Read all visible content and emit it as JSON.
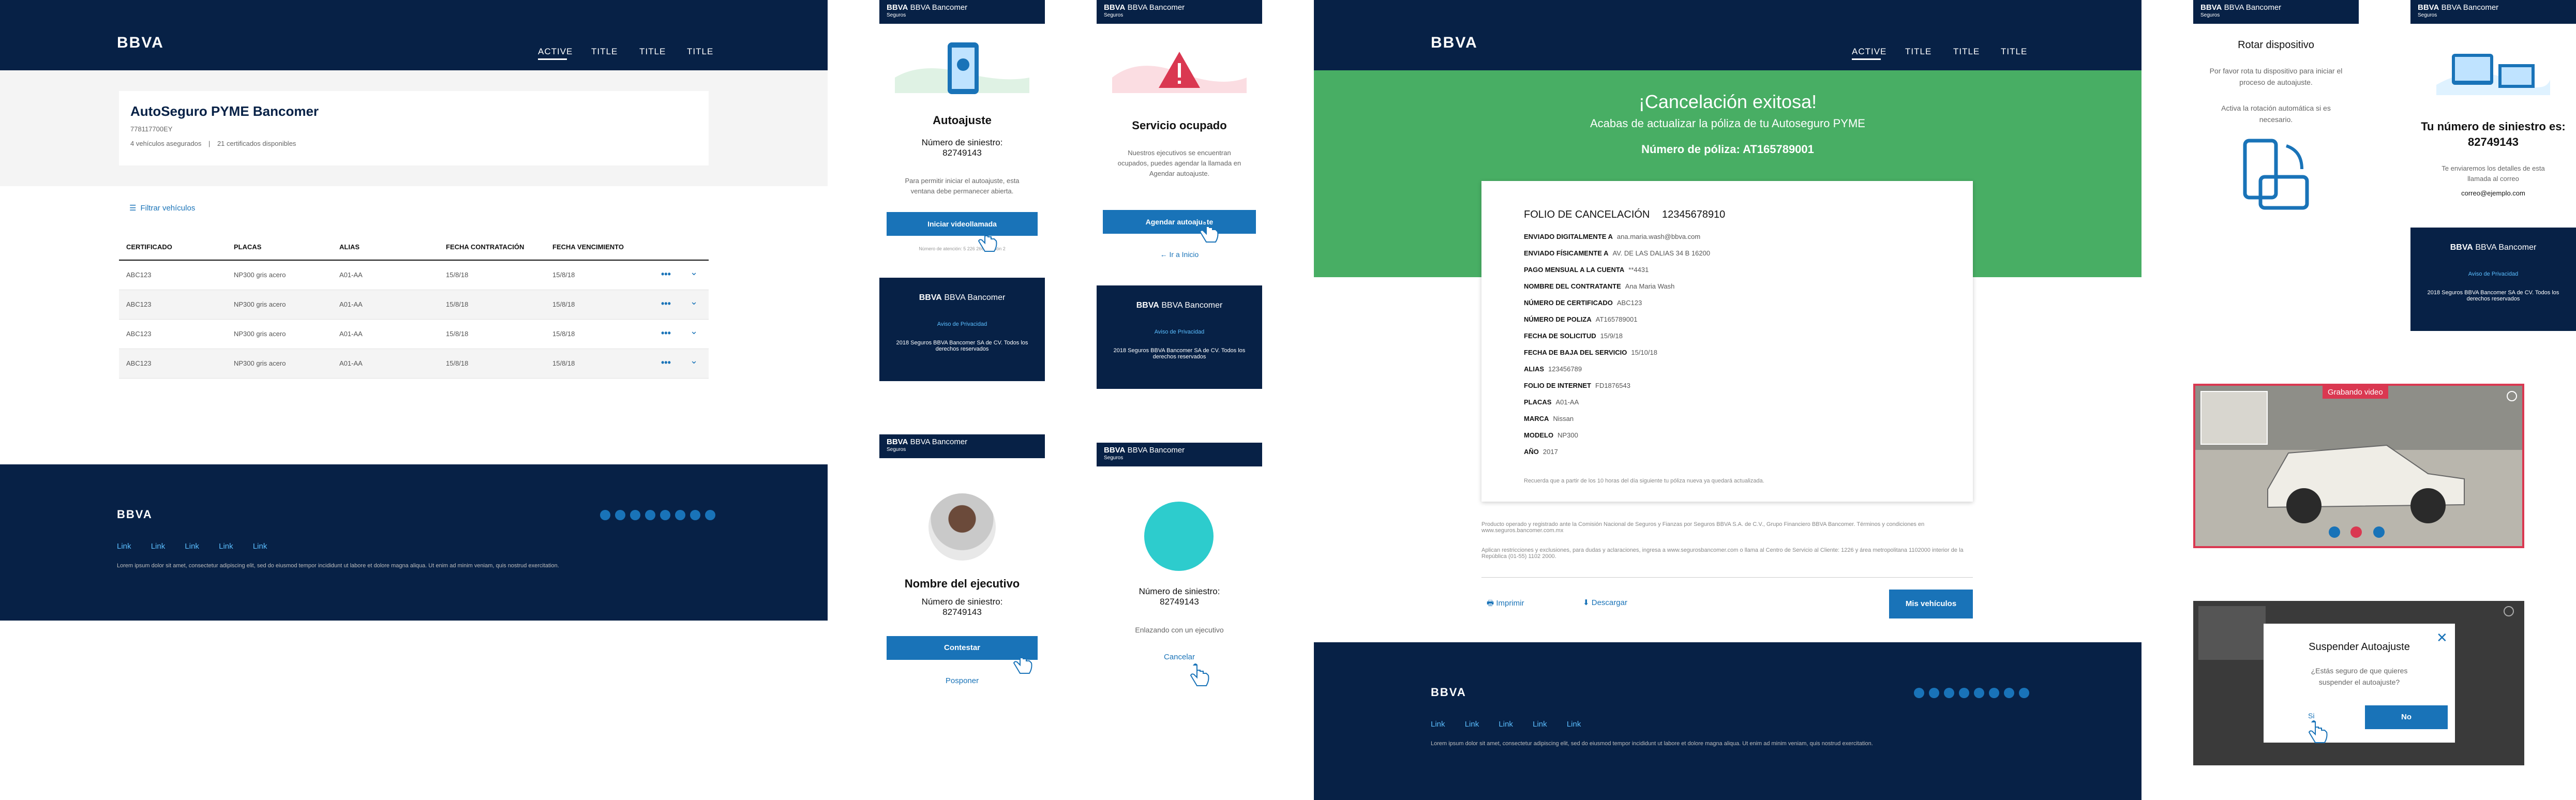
{
  "colors": {
    "navy": "#072146",
    "blue": "#1973b8",
    "green": "#48ae64",
    "red": "#da3851",
    "light": "#f4f4f4"
  },
  "s1": {
    "logo": "BBVA",
    "nav": [
      "ACTIVE",
      "TITLE",
      "TITLE",
      "TITLE"
    ],
    "card": {
      "title": "AutoSeguro PYME Bancomer",
      "id": "778117700EY",
      "vehicles": "4 vehículos asegurados",
      "sep": "|",
      "certs": "21 certificados disponibles"
    },
    "filter": "Filtrar vehículos",
    "headers": [
      "CERTIFICADO",
      "PLACAS",
      "ALIAS",
      "FECHA CONTRATACIÓN",
      "FECHA VENCIMIENTO"
    ],
    "rows": [
      [
        "ABC123",
        "NP300 gris acero",
        "A01-AA",
        "15/8/18",
        "15/8/18"
      ],
      [
        "ABC123",
        "NP300 gris acero",
        "A01-AA",
        "15/8/18",
        "15/8/18"
      ],
      [
        "ABC123",
        "NP300 gris acero",
        "A01-AA",
        "15/8/18",
        "15/8/18"
      ],
      [
        "ABC123",
        "NP300 gris acero",
        "A01-AA",
        "15/8/18",
        "15/8/18"
      ]
    ],
    "more": "•••",
    "chevron": "⌄",
    "footer": {
      "logo": "BBVA",
      "links": [
        "Link",
        "Link",
        "Link",
        "Link",
        "Link"
      ],
      "legal": "Lorem ipsum dolor sit amet, consectetur adipiscing elit, sed do eiusmod tempor incididunt ut labore et dolore magna aliqua. Ut enim ad minim veniam, quis nostrud exercitation."
    }
  },
  "m": {
    "brand": "BBVA Bancomer",
    "brand_sub": "Seguros",
    "a": {
      "title": "Autoajuste",
      "label": "Número de siniestro:",
      "number": "82749143",
      "desc": "Para permitir iniciar el autoajuste, esta ventana debe permanecer abierta.",
      "button": "Iniciar videollamada",
      "note": "Número de atención: 5 226 2663 opción 2"
    },
    "b": {
      "title": "Servicio ocupado",
      "desc": "Nuestros ejecutivos se encuentran ocupados, puedes agendar la llamada en Agendar autoajuste.",
      "button": "Agendar autoajuste",
      "back": "Ir a Inicio"
    },
    "footer": {
      "privacy": "Aviso de Privacidad",
      "legal": "2018 Seguros BBVA Bancomer SA de CV. Todos los derechos reservados"
    },
    "c": {
      "title": "Nombre del ejecutivo",
      "label": "Número de siniestro:",
      "number": "82749143",
      "button": "Contestar",
      "link": "Posponer"
    },
    "d": {
      "label": "Número de siniestro:",
      "number": "82749143",
      "desc": "Enlazando con un ejecutivo",
      "link": "Cancelar"
    }
  },
  "s3": {
    "logo": "BBVA",
    "nav": [
      "ACTIVE",
      "TITLE",
      "TITLE",
      "TITLE"
    ],
    "title": "¡Cancelación exitosa!",
    "subtitle": "Acabas de actualizar la póliza de tu Autoseguro PYME",
    "policy": "Número de póliza: AT165789001",
    "folio_label": "FOLIO DE CANCELACIÓN",
    "folio": "12345678910",
    "details": [
      {
        "k": "ENVIADO DIGITALMENTE A",
        "v": "ana.maria.wash@bbva.com"
      },
      {
        "k": "ENVIADO FÍSICAMENTE A",
        "v": "AV. DE LAS DALIAS 34 B 16200"
      },
      {
        "k": "PAGO MENSUAL A LA CUENTA",
        "v": "**4431"
      },
      {
        "k": "NOMBRE DEL CONTRATANTE",
        "v": "Ana Maria Wash"
      },
      {
        "k": "NÚMERO DE CERTIFICADO",
        "v": "ABC123"
      },
      {
        "k": "NÚMERO DE POLIZA",
        "v": "AT165789001"
      },
      {
        "k": "FECHA DE SOLICITUD",
        "v": "15/9/18"
      },
      {
        "k": "FECHA DE BAJA DEL SERVICIO",
        "v": "15/10/18"
      },
      {
        "k": "ALIAS",
        "v": "123456789"
      },
      {
        "k": "FOLIO DE INTERNET",
        "v": "FD1876543"
      },
      {
        "k": "PLACAS",
        "v": "A01-AA"
      },
      {
        "k": "MARCA",
        "v": "Nissan"
      },
      {
        "k": "MODELO",
        "v": "NP300"
      },
      {
        "k": "AÑO",
        "v": "2017"
      }
    ],
    "reminder": "Recuerda que a partir de los 10 horas del día siguiente tu póliza nueva ya quedará actualizada.",
    "legal1": "Producto operado y registrado ante la Comisión Nacional de Seguros y Fianzas por Seguros BBVA S.A. de C.V., Grupo Financiero BBVA Bancomer. Términos y condiciones en www.seguros.bancomer.com.mx",
    "legal2": "Aplican restricciones y exclusiones, para dudas y aclaraciones, ingresa a www.segurosbancomer.com o llama al Centro de Servicio al Cliente: 1226 y área metropolitana 1102000 interior de la República (01-55) 1102 2000.",
    "print": "Imprimir",
    "download": "Descargar",
    "button": "Mis vehículos",
    "footer": {
      "logo": "BBVA",
      "links": [
        "Link",
        "Link",
        "Link",
        "Link",
        "Link"
      ],
      "legal": "Lorem ipsum dolor sit amet, consectetur adipiscing elit, sed do eiusmod tempor incididunt ut labore et dolore magna aliqua. Ut enim ad minim veniam, quis nostrud exercitation."
    }
  },
  "r": {
    "brand": "BBVA Bancomer",
    "brand_sub": "Seguros",
    "rotate": {
      "title": "Rotar dispositivo",
      "desc": "Por favor rota tu dispositivo para iniciar el proceso de autoajuste.",
      "desc2": "Activa la rotación automática si es necesario."
    },
    "claim": {
      "title": "Tu número de siniestro es:",
      "number": "82749143",
      "desc": "Te enviaremos los detalles de esta llamada al correo",
      "email": "correo@ejemplo.com"
    },
    "footer": {
      "privacy": "Aviso de Privacidad",
      "legal": "2018 Seguros BBVA Bancomer SA de CV. Todos los derechos reservados"
    },
    "video": {
      "rec": "Grabando video"
    },
    "modal": {
      "title": "Suspender Autoajuste",
      "question": "¿Estás seguro de que quieres suspender el autoajuste?",
      "yes": "Si",
      "no": "No"
    }
  }
}
